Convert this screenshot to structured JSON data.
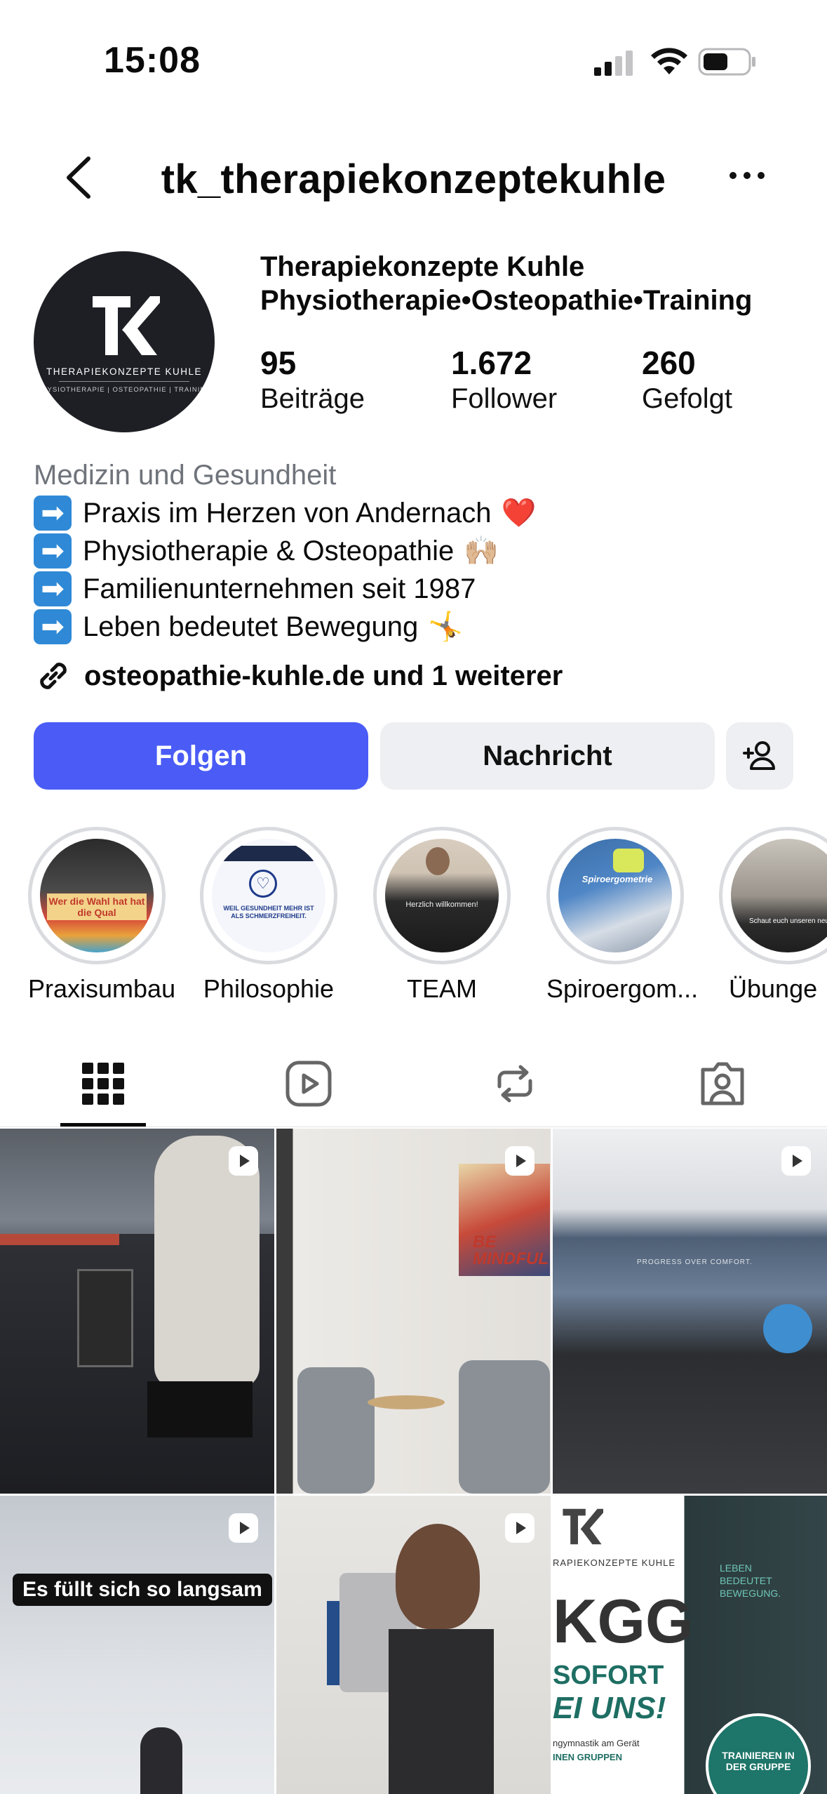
{
  "status_bar": {
    "time": "15:08"
  },
  "nav": {
    "handle": "tk_therapiekonzeptekuhle"
  },
  "profile": {
    "avatar": {
      "brand_name": "THERAPIEKONZEPTE KUHLE",
      "brand_sub": "PHYSIOTHERAPIE | OSTEOPATHIE | TRAINING"
    },
    "name_line1": "Therapiekonzepte Kuhle",
    "name_line2": "Physiotherapie•Osteopathie•Training",
    "stats": [
      {
        "value": "95",
        "label": "Beiträge"
      },
      {
        "value": "1.672",
        "label": "Follower"
      },
      {
        "value": "260",
        "label": "Gefolgt"
      }
    ]
  },
  "bio": {
    "category": "Medizin und Gesundheit",
    "lines": [
      {
        "text": "Praxis im Herzen von Andernach",
        "emoji": "❤️"
      },
      {
        "text": "Physiotherapie & Osteopathie",
        "emoji": "🙌🏼"
      },
      {
        "text": "Familienunternehmen seit 1987",
        "emoji": ""
      },
      {
        "text": "Leben bedeutet Bewegung",
        "emoji": "🤸"
      }
    ],
    "link": "osteopathie-kuhle.de und 1 weiterer"
  },
  "buttons": {
    "follow": "Folgen",
    "message": "Nachricht"
  },
  "highlights": [
    {
      "label": "Praxisumbau",
      "img_text": "Wer die Wahl hat hat die Qual"
    },
    {
      "label": "Philosophie",
      "img_text": "WEIL GESUNDHEIT MEHR IST ALS SCHMERZFREIHEIT."
    },
    {
      "label": "TEAM",
      "img_text": "Herzlich willkommen!"
    },
    {
      "label": "Spiroergom...",
      "img_text": "Spiroergometrie"
    },
    {
      "label": "Übunge",
      "img_text": "Schaut euch unseren neu"
    }
  ],
  "tabs": [
    "grid-icon",
    "reels-icon",
    "reposts-icon",
    "tagged-icon"
  ],
  "grid": {
    "caption_post4": "Es füllt sich so langsam",
    "post3_text": "PROGRESS OVER COMFORT.",
    "post2_text": "BE MINDFUL",
    "post6": {
      "brand": "RAPIEKONZEPTE KUHLE",
      "big": "KGG",
      "sofort": "SOFORT",
      "uns": "EI UNS!",
      "sub": "ngymnastik am Gerät",
      "groups": "INEN GRUPPEN",
      "tagline": "LEBEN BEDEUTET BEWEGUNG.",
      "badge": "TRAINIEREN IN DER GRUPPE"
    }
  },
  "colors": {
    "follow": "#4a5cf5",
    "secondary_btn": "#eeeff2",
    "category": "#6f737a"
  }
}
